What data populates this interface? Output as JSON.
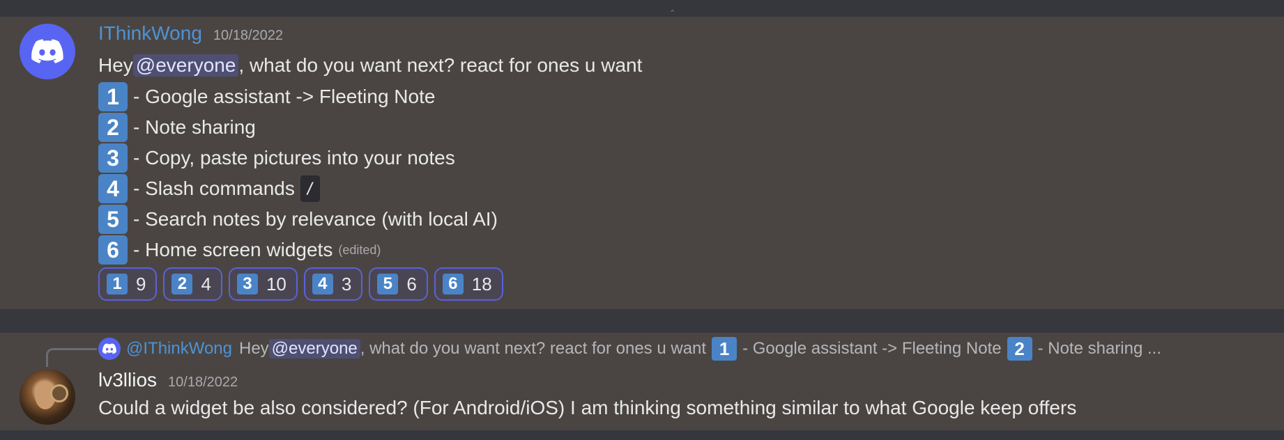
{
  "top_indicator": "‸",
  "message1": {
    "username": "IThinkWong",
    "timestamp": "10/18/2022",
    "intro_pre": "Hey ",
    "intro_mention": "@everyone",
    "intro_post": ", what do you want next? react for ones u want",
    "items": [
      {
        "key": "1",
        "text": "- Google assistant -> Fleeting Note"
      },
      {
        "key": "2",
        "text": "- Note sharing"
      },
      {
        "key": "3",
        "text": "- Copy, paste pictures into your notes"
      },
      {
        "key": "4",
        "text": "- Slash commands",
        "code": "/"
      },
      {
        "key": "5",
        "text": "- Search notes by relevance (with local AI)"
      },
      {
        "key": "6",
        "text": "- Home screen widgets",
        "edited": "(edited)"
      }
    ],
    "reactions": [
      {
        "key": "1",
        "count": "9"
      },
      {
        "key": "2",
        "count": "4"
      },
      {
        "key": "3",
        "count": "10"
      },
      {
        "key": "4",
        "count": "3"
      },
      {
        "key": "5",
        "count": "6"
      },
      {
        "key": "6",
        "count": "18"
      }
    ]
  },
  "message2": {
    "reply": {
      "author": "@IThinkWong",
      "pre": "Hey ",
      "mention": "@everyone",
      "mid": ", what do you want next? react for ones u want",
      "key1": "1",
      "text1": "- Google assistant -> Fleeting Note",
      "key2": "2",
      "text2": "- Note sharing ..."
    },
    "username": "lv3llios",
    "timestamp": "10/18/2022",
    "text": "Could a widget be also considered? (For Android/iOS) I am thinking something similar to what Google keep offers"
  },
  "colors": {
    "accent": "#5865f2",
    "username_blue": "#4e93d6",
    "keycap_blue": "#4a84c6",
    "message_bg": "#4a4543"
  }
}
